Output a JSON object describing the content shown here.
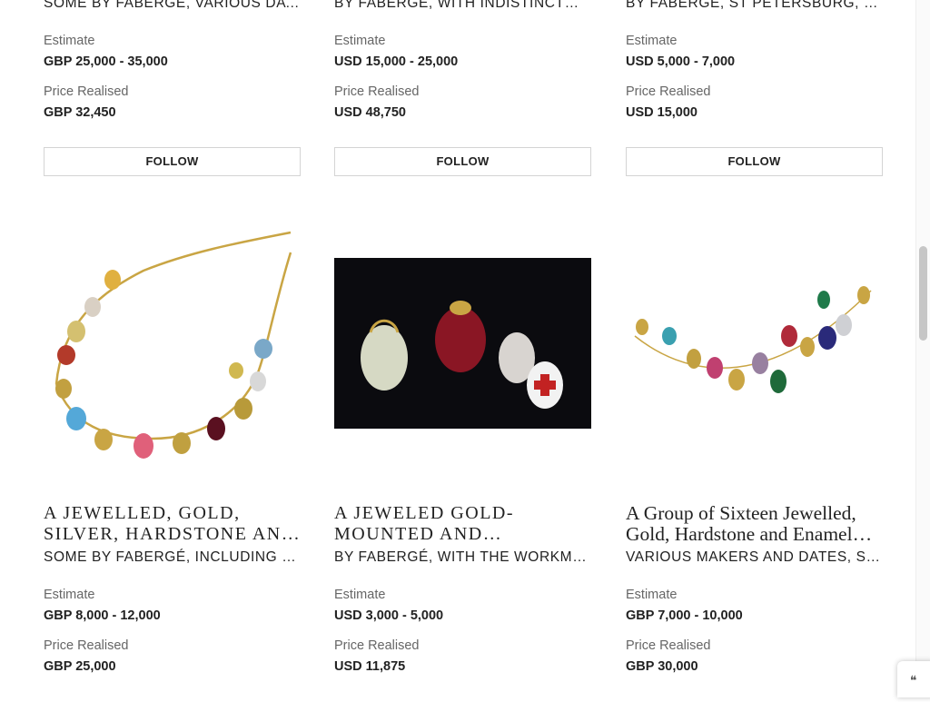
{
  "row1": [
    {
      "subtitle": "SOME BY FABERGÉ, VARIOUS DATE AN…",
      "estimate_label": "Estimate",
      "estimate": "GBP 25,000 - 35,000",
      "price_label": "Price Realised",
      "price": "GBP 32,450",
      "follow": "FOLLOW"
    },
    {
      "subtitle": "BY FABERGÉ, WITH INDISTINCT…",
      "estimate_label": "Estimate",
      "estimate": "USD 15,000 - 25,000",
      "price_label": "Price Realised",
      "price": "USD 48,750",
      "follow": "FOLLOW"
    },
    {
      "subtitle": "BY FABERGÉ, ST PETERSBURG, CIRCA…",
      "estimate_label": "Estimate",
      "estimate": "USD 5,000 - 7,000",
      "price_label": "Price Realised",
      "price": "USD 15,000",
      "follow": "FOLLOW"
    }
  ],
  "row2": [
    {
      "title": "A JEWELLED, GOLD, SILVER, HARDSTONE AND ENAMEL…",
      "subtitle": "SOME BY FABERGÉ, INCLUDING WITH…",
      "estimate_label": "Estimate",
      "estimate": "GBP 8,000 - 12,000",
      "price_label": "Price Realised",
      "price": "GBP 25,000"
    },
    {
      "title": "A JEWELED GOLD-MOUNTED AND PURPURINE EGG…",
      "subtitle": "BY FABERGÉ, WITH THE WORKMASTER'…",
      "estimate_label": "Estimate",
      "estimate": "USD 3,000 - 5,000",
      "price_label": "Price Realised",
      "price": "USD 11,875"
    },
    {
      "title": "A Group of Sixteen Jewelled, Gold, Hardstone and Enamel Egg Pendants",
      "subtitle": "VARIOUS MAKERS AND DATES, SOME…",
      "estimate_label": "Estimate",
      "estimate": "GBP 7,000 - 10,000",
      "price_label": "Price Realised",
      "price": "GBP 30,000"
    }
  ]
}
